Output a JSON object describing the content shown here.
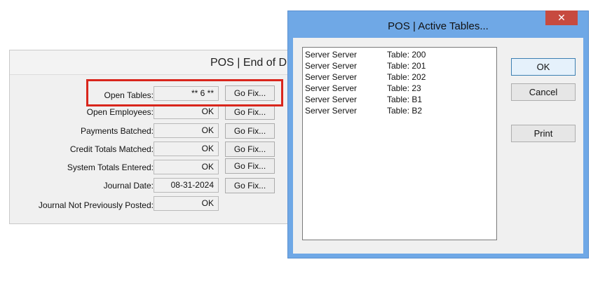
{
  "eod": {
    "title": "POS | End of D",
    "rows": [
      {
        "label": "Open Tables:",
        "value": "** 6 **",
        "button": "Go Fix..."
      },
      {
        "label": "Open Employees:",
        "value": "OK",
        "button": "Go Fix..."
      },
      {
        "label": "Payments Batched:",
        "value": "OK",
        "button": "Go Fix..."
      },
      {
        "label": "Credit Totals Matched:",
        "value": "OK",
        "button": "Go Fix..."
      },
      {
        "label": "System Totals Entered:",
        "value": "OK",
        "button": "Go Fix..."
      },
      {
        "label": "Journal Date:",
        "value": "08-31-2024",
        "button": "Go Fix..."
      },
      {
        "label": "Journal Not Previously Posted:",
        "value": "OK"
      }
    ]
  },
  "dialog": {
    "title": "POS | Active Tables...",
    "close_glyph": "✕",
    "list": [
      {
        "server": "Server Server",
        "table": "Table: 200"
      },
      {
        "server": "Server Server",
        "table": "Table: 201"
      },
      {
        "server": "Server Server",
        "table": "Table: 202"
      },
      {
        "server": "Server Server",
        "table": "Table: 23"
      },
      {
        "server": "Server Server",
        "table": "Table: B1"
      },
      {
        "server": "Server Server",
        "table": "Table: B2"
      }
    ],
    "buttons": {
      "ok": "OK",
      "cancel": "Cancel",
      "print": "Print"
    }
  },
  "colors": {
    "highlight": "#d9261c",
    "dialog_frame": "#6fa8e6",
    "close_button": "#c74a3f"
  }
}
